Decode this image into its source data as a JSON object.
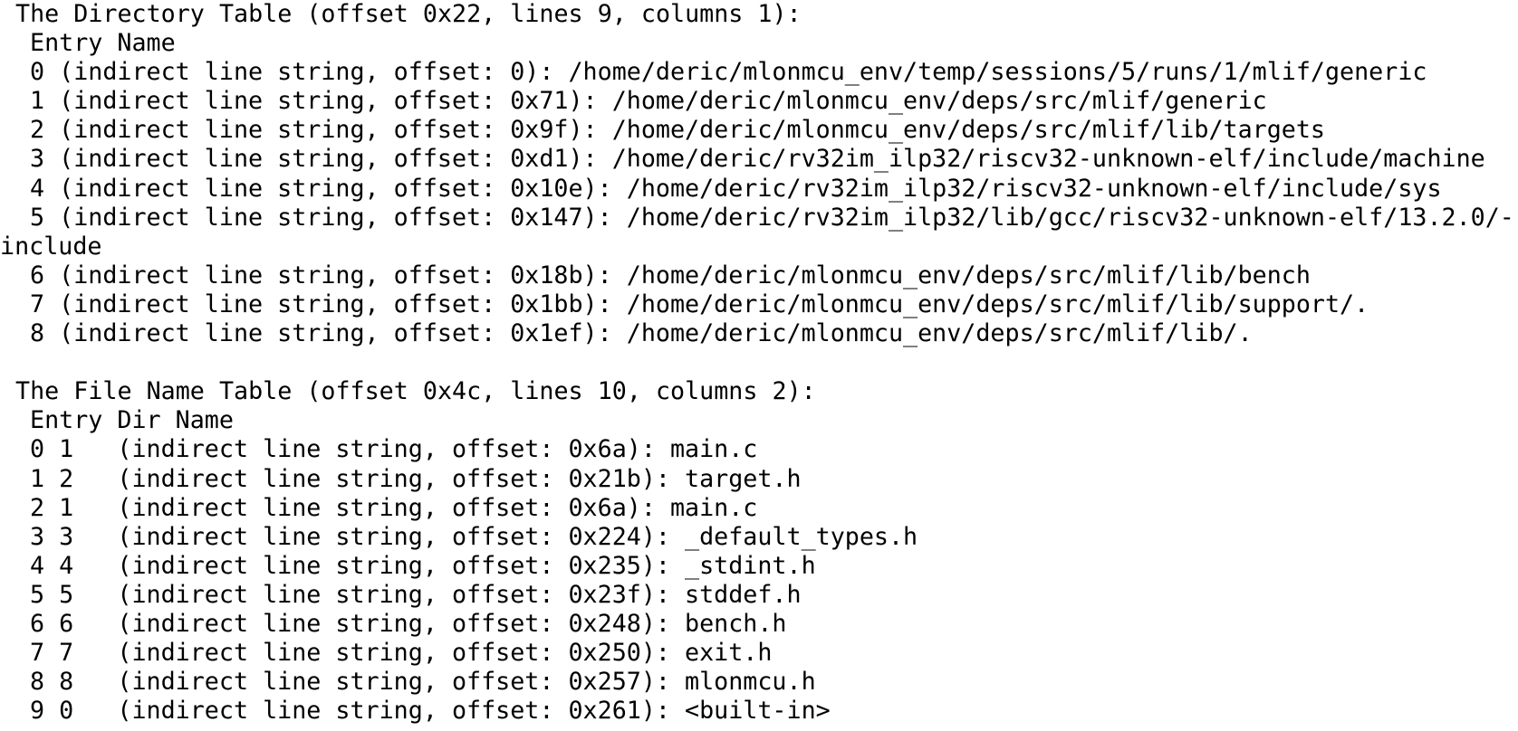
{
  "directory_table": {
    "header": "The Directory Table (offset 0x22, lines 9, columns 1):",
    "column_header": "Entry Name",
    "entries": [
      "0 (indirect line string, offset: 0): /home/deric/mlonmcu_env/temp/sessions/5/runs/1/mlif/generic",
      "1 (indirect line string, offset: 0x71): /home/deric/mlonmcu_env/deps/src/mlif/generic",
      "2 (indirect line string, offset: 0x9f): /home/deric/mlonmcu_env/deps/src/mlif/lib/targets",
      "3 (indirect line string, offset: 0xd1): /home/deric/rv32im_ilp32/riscv32-unknown-elf/include/machine",
      "4 (indirect line string, offset: 0x10e): /home/deric/rv32im_ilp32/riscv32-unknown-elf/include/sys",
      "5 (indirect line string, offset: 0x147): /home/deric/rv32im_ilp32/lib/gcc/riscv32-unknown-elf/13.2.0/-",
      "6 (indirect line string, offset: 0x18b): /home/deric/mlonmcu_env/deps/src/mlif/lib/bench",
      "7 (indirect line string, offset: 0x1bb): /home/deric/mlonmcu_env/deps/src/mlif/lib/support/.",
      "8 (indirect line string, offset: 0x1ef): /home/deric/mlonmcu_env/deps/src/mlif/lib/."
    ],
    "wrap_continuation": "include"
  },
  "file_name_table": {
    "header": "The File Name Table (offset 0x4c, lines 10, columns 2):",
    "column_header": "Entry Dir Name",
    "entries": [
      "0 1   (indirect line string, offset: 0x6a): main.c",
      "1 2   (indirect line string, offset: 0x21b): target.h",
      "2 1   (indirect line string, offset: 0x6a): main.c",
      "3 3   (indirect line string, offset: 0x224): _default_types.h",
      "4 4   (indirect line string, offset: 0x235): _stdint.h",
      "5 5   (indirect line string, offset: 0x23f): stddef.h",
      "6 6   (indirect line string, offset: 0x248): bench.h",
      "7 7   (indirect line string, offset: 0x250): exit.h",
      "8 8   (indirect line string, offset: 0x257): mlonmcu.h",
      "9 0   (indirect line string, offset: 0x261): <built-in>"
    ]
  },
  "colors": {
    "background": "#ffffff",
    "text": "#000000"
  }
}
